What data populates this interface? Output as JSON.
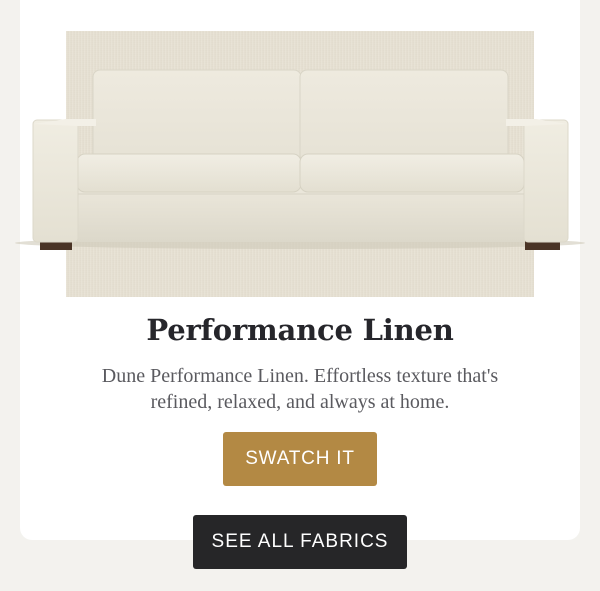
{
  "product": {
    "title": "Performance Linen",
    "description": "Dune Performance Linen. Effortless texture that's refined, relaxed, and always at home.",
    "image_alt": "sofa-image"
  },
  "actions": {
    "swatch_label": "SWATCH IT",
    "all_fabrics_label": "SEE ALL FABRICS"
  },
  "colors": {
    "background": "#f3f2ee",
    "card": "#ffffff",
    "fabric": "#e8e2d3",
    "sofa_fabric": "#ede9dc",
    "swatch_button": "#b38944",
    "all_fabrics_button": "#262628",
    "title_text": "#26262b",
    "body_text": "#5a5a5f"
  }
}
